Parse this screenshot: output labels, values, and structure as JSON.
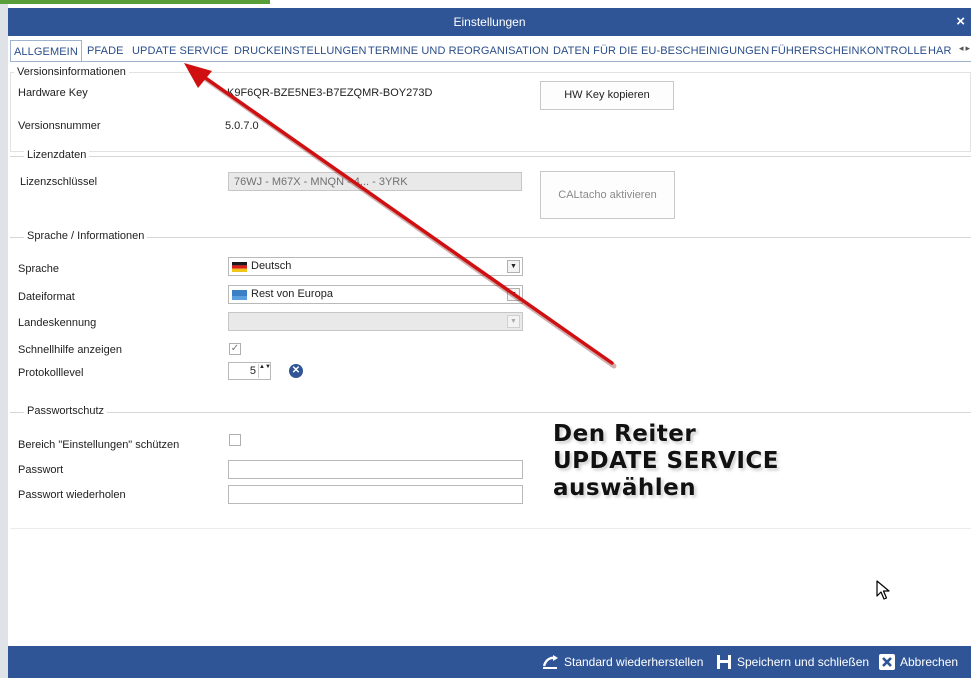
{
  "window": {
    "title": "Einstellungen",
    "close_glyph": "×"
  },
  "tabs": [
    {
      "label": "ALLGEMEIN",
      "active": true
    },
    {
      "label": "PFADE"
    },
    {
      "label": "UPDATE SERVICE"
    },
    {
      "label": "DRUCKEINSTELLUNGEN"
    },
    {
      "label": "TERMINE UND REORGANISATION"
    },
    {
      "label": "DATEN FÜR DIE EU-BESCHEINIGUNGEN"
    },
    {
      "label": "FÜHRERSCHEINKONTROLLE"
    },
    {
      "label": "HAR"
    }
  ],
  "tab_scroll": {
    "left": "◂",
    "right": "▸"
  },
  "versions": {
    "group_title": "Versionsinformationen",
    "hardware_key_label": "Hardware Key",
    "hardware_key_value": "K9F6QR-BZE5NE3-B7EZQMR-BOY273D",
    "copy_button": "HW Key kopieren",
    "version_label": "Versionsnummer",
    "version_value": "5.0.7.0"
  },
  "license": {
    "group_title": "Lizenzdaten",
    "key_label": "Lizenzschlüssel",
    "key_value": "76WJ - M67X - MNQN - 4... - 3YRK",
    "activate_button": "CALtacho aktivieren"
  },
  "language": {
    "group_title": "Sprache / Informationen",
    "sprache_label": "Sprache",
    "sprache_value": "Deutsch",
    "dateiformat_label": "Dateiformat",
    "dateiformat_value": "Rest von Europa",
    "landeskennung_label": "Landeskennung",
    "landeskennung_value": "",
    "schnellhilfe_label": "Schnellhilfe anzeigen",
    "schnellhilfe_checked": true,
    "check_glyph": "✓",
    "protokolllevel_label": "Protokolllevel",
    "protokolllevel_value": "5",
    "spin_glyphs": "▲▼",
    "reset_glyph": "✕"
  },
  "password": {
    "group_title": "Passwortschutz",
    "protect_label": "Bereich \"Einstellungen\" schützen",
    "protect_checked": false,
    "passwort_label": "Passwort",
    "passwort_value": "",
    "repeat_label": "Passwort wiederholen",
    "repeat_value": ""
  },
  "annotation": {
    "line1": "Den Reiter",
    "line2": "UPDATE SERVICE",
    "line3": "auswählen",
    "arrow_color": "#d01010"
  },
  "footer": {
    "restore_label": "Standard wiederherstellen",
    "save_label": "Speichern und schließen",
    "cancel_label": "Abbrechen"
  },
  "colors": {
    "accent_blue": "#2f5597",
    "tab_text": "#2b4e8a",
    "arrow_red": "#d01010",
    "green_strip": "#5a9e3a"
  }
}
